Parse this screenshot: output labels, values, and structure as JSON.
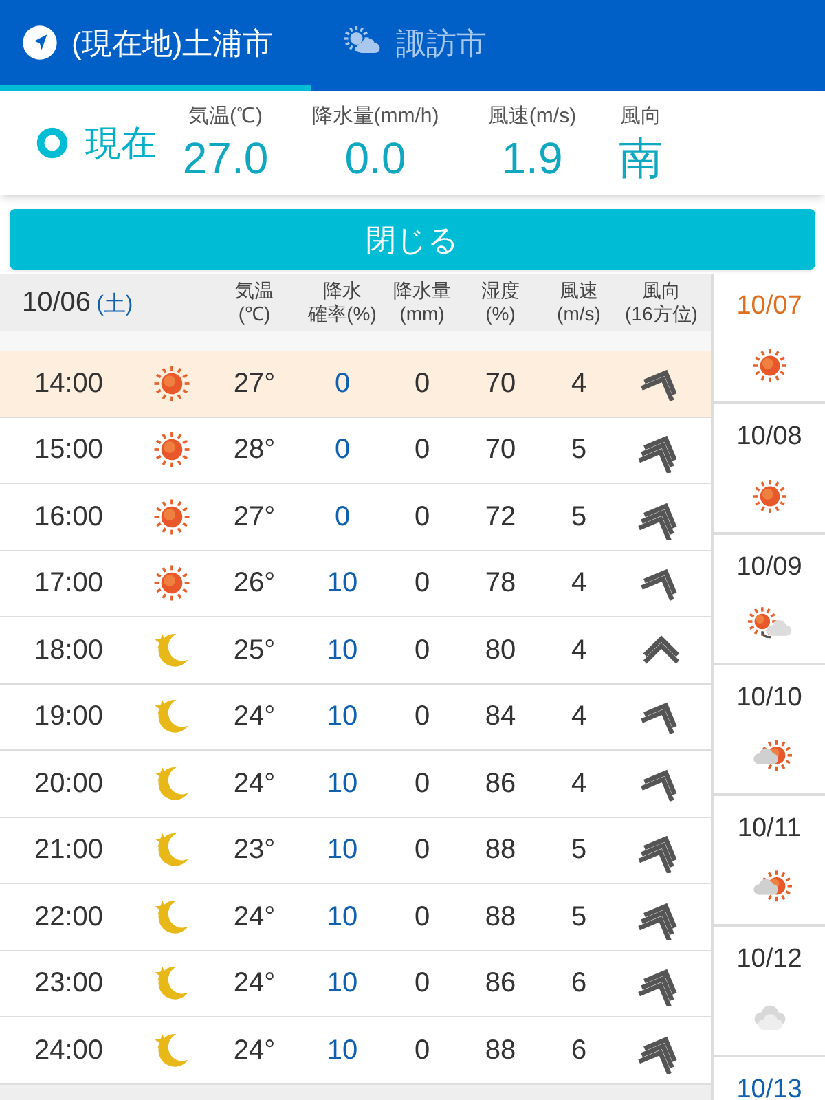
{
  "tabs": [
    {
      "label": "(現在地)土浦市",
      "kind": "location",
      "selected": true
    },
    {
      "label": "諏訪市",
      "kind": "weather",
      "selected": false
    }
  ],
  "current": {
    "label": "現在",
    "readings": [
      {
        "label": "気温(℃)",
        "value": "27.0"
      },
      {
        "label": "降水量(mm/h)",
        "value": "0.0"
      },
      {
        "label": "風速(m/s)",
        "value": "1.9"
      },
      {
        "label": "風向",
        "value": "南"
      }
    ]
  },
  "close_button": "閉じる",
  "table": {
    "date": "10/06",
    "weekday": "(土)",
    "columns": [
      [
        "気温",
        "(℃)"
      ],
      [
        "降水",
        "確率(%)"
      ],
      [
        "降水量",
        "(mm)"
      ],
      [
        "湿度",
        "(%)"
      ],
      [
        "風速",
        "(m/s)"
      ],
      [
        "風向",
        "(16方位)"
      ]
    ],
    "rows": [
      {
        "time": "14:00",
        "weather": {
          "kind": "sun"
        },
        "temp": "27°",
        "pop": "0",
        "rain": "0",
        "humidity": "70",
        "wind": "4",
        "wind_arrow": {
          "kind": "double"
        },
        "selected": true
      },
      {
        "time": "15:00",
        "weather": {
          "kind": "sun"
        },
        "temp": "28°",
        "pop": "0",
        "rain": "0",
        "humidity": "70",
        "wind": "5",
        "wind_arrow": {
          "kind": "triple"
        },
        "selected": false
      },
      {
        "time": "16:00",
        "weather": {
          "kind": "sun"
        },
        "temp": "27°",
        "pop": "0",
        "rain": "0",
        "humidity": "72",
        "wind": "5",
        "wind_arrow": {
          "kind": "triple"
        },
        "selected": false
      },
      {
        "time": "17:00",
        "weather": {
          "kind": "sun"
        },
        "temp": "26°",
        "pop": "10",
        "rain": "0",
        "humidity": "78",
        "wind": "4",
        "wind_arrow": {
          "kind": "double"
        },
        "selected": false
      },
      {
        "time": "18:00",
        "weather": {
          "kind": "moon"
        },
        "temp": "25°",
        "pop": "10",
        "rain": "0",
        "humidity": "80",
        "wind": "4",
        "wind_arrow": {
          "kind": "upright"
        },
        "selected": false
      },
      {
        "time": "19:00",
        "weather": {
          "kind": "moon"
        },
        "temp": "24°",
        "pop": "10",
        "rain": "0",
        "humidity": "84",
        "wind": "4",
        "wind_arrow": {
          "kind": "double"
        },
        "selected": false
      },
      {
        "time": "20:00",
        "weather": {
          "kind": "moon"
        },
        "temp": "24°",
        "pop": "10",
        "rain": "0",
        "humidity": "86",
        "wind": "4",
        "wind_arrow": {
          "kind": "double"
        },
        "selected": false
      },
      {
        "time": "21:00",
        "weather": {
          "kind": "moon"
        },
        "temp": "23°",
        "pop": "10",
        "rain": "0",
        "humidity": "88",
        "wind": "5",
        "wind_arrow": {
          "kind": "triple"
        },
        "selected": false
      },
      {
        "time": "22:00",
        "weather": {
          "kind": "moon"
        },
        "temp": "24°",
        "pop": "10",
        "rain": "0",
        "humidity": "88",
        "wind": "5",
        "wind_arrow": {
          "kind": "triple"
        },
        "selected": false
      },
      {
        "time": "23:00",
        "weather": {
          "kind": "moon"
        },
        "temp": "24°",
        "pop": "10",
        "rain": "0",
        "humidity": "86",
        "wind": "6",
        "wind_arrow": {
          "kind": "triple"
        },
        "selected": false
      },
      {
        "time": "24:00",
        "weather": {
          "kind": "moon"
        },
        "temp": "24°",
        "pop": "10",
        "rain": "0",
        "humidity": "88",
        "wind": "6",
        "wind_arrow": {
          "kind": "triple"
        },
        "selected": false
      }
    ]
  },
  "days": [
    {
      "date": "10/07",
      "weather": {
        "kind": "sun"
      },
      "color": "#e07020"
    },
    {
      "date": "10/08",
      "weather": {
        "kind": "sun"
      },
      "color": "#333333"
    },
    {
      "date": "10/09",
      "weather": {
        "kind": "suncloud"
      },
      "color": "#333333"
    },
    {
      "date": "10/10",
      "weather": {
        "kind": "cloudsun"
      },
      "color": "#333333"
    },
    {
      "date": "10/11",
      "weather": {
        "kind": "cloudsun"
      },
      "color": "#333333"
    },
    {
      "date": "10/12",
      "weather": {
        "kind": "cloud"
      },
      "color": "#333333"
    },
    {
      "date": "10/13",
      "color": "#1060b0"
    }
  ]
}
